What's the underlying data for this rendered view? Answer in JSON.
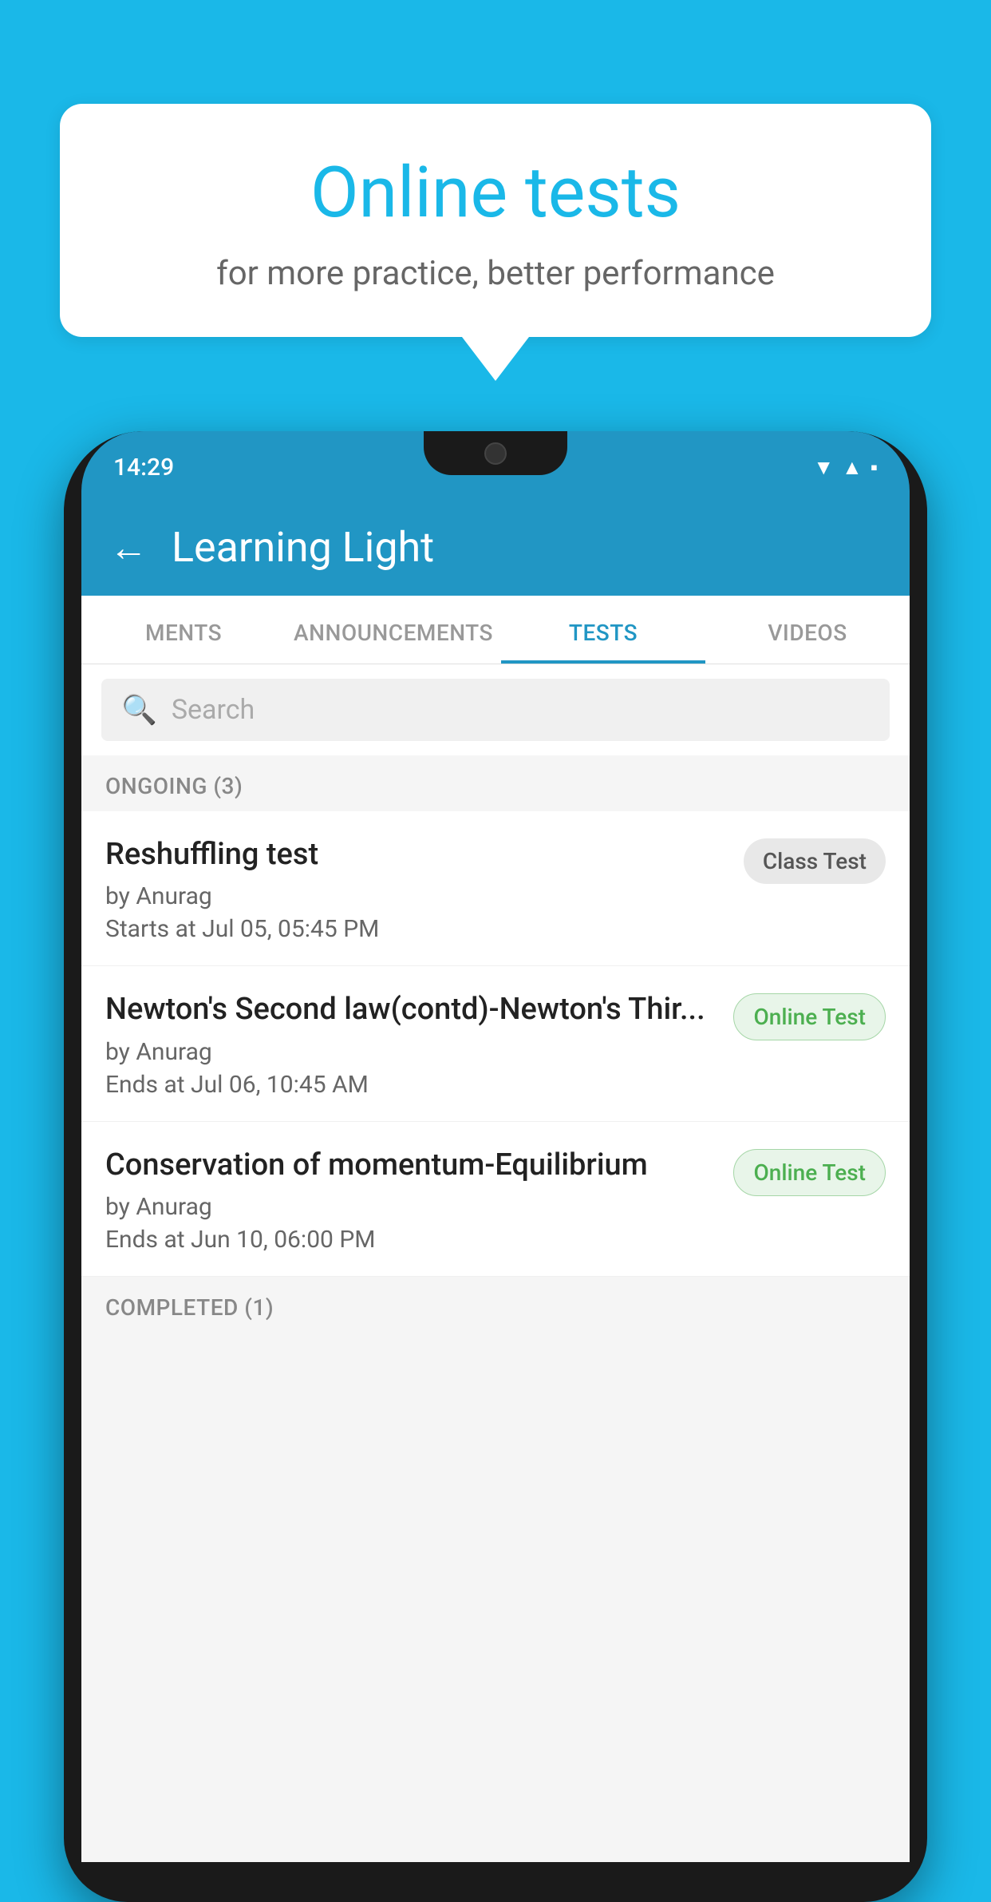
{
  "background": {
    "color": "#1ab8e8"
  },
  "speech_bubble": {
    "title": "Online tests",
    "subtitle": "for more practice, better performance"
  },
  "phone": {
    "status_bar": {
      "time": "14:29",
      "icons": [
        "wifi",
        "signal",
        "battery"
      ]
    },
    "app_header": {
      "back_label": "←",
      "title": "Learning Light"
    },
    "tabs": [
      {
        "label": "MENTS",
        "active": false
      },
      {
        "label": "ANNOUNCEMENTS",
        "active": false
      },
      {
        "label": "TESTS",
        "active": true
      },
      {
        "label": "VIDEOS",
        "active": false
      }
    ],
    "search": {
      "placeholder": "Search"
    },
    "sections": [
      {
        "header": "ONGOING (3)",
        "items": [
          {
            "title": "Reshuffling test",
            "by": "by Anurag",
            "date": "Starts at  Jul 05, 05:45 PM",
            "badge": "Class Test",
            "badge_type": "class"
          },
          {
            "title": "Newton's Second law(contd)-Newton's Thir...",
            "by": "by Anurag",
            "date": "Ends at  Jul 06, 10:45 AM",
            "badge": "Online Test",
            "badge_type": "online"
          },
          {
            "title": "Conservation of momentum-Equilibrium",
            "by": "by Anurag",
            "date": "Ends at  Jun 10, 06:00 PM",
            "badge": "Online Test",
            "badge_type": "online"
          }
        ]
      }
    ],
    "completed_section": {
      "header": "COMPLETED (1)"
    }
  }
}
